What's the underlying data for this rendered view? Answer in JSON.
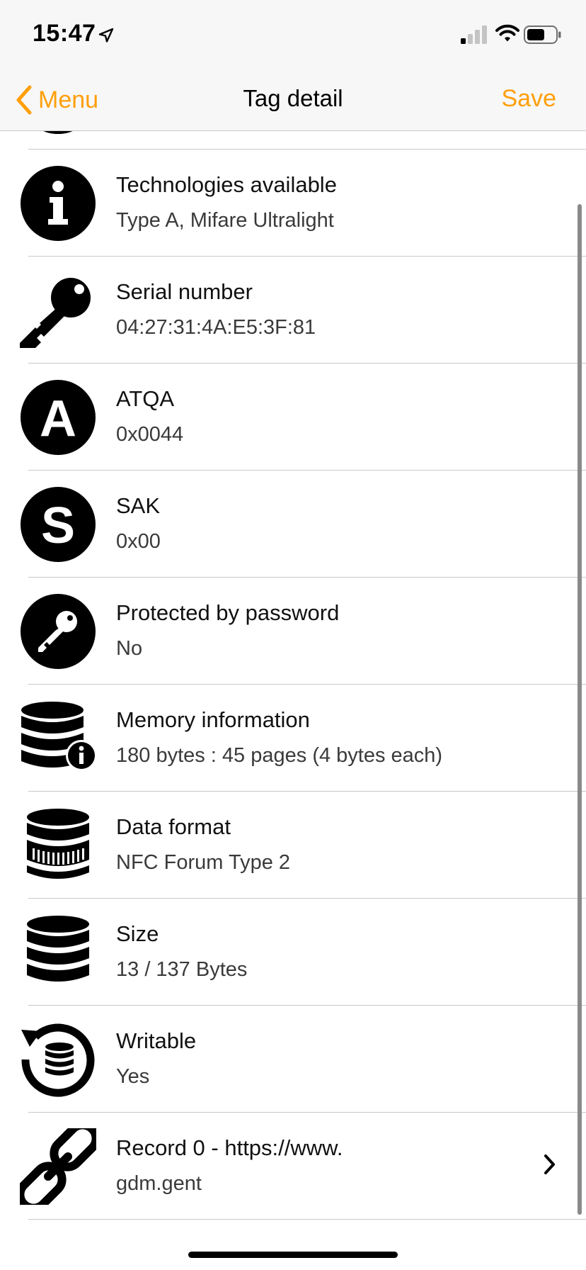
{
  "status_bar": {
    "time": "15:47"
  },
  "nav": {
    "back_label": "Menu",
    "title": "Tag detail",
    "save_label": "Save"
  },
  "rows": [
    {
      "icon": "info-icon",
      "title": "Technologies available",
      "value": "Type A, Mifare Ultralight"
    },
    {
      "icon": "key-icon",
      "title": "Serial number",
      "value": "04:27:31:4A:E5:3F:81"
    },
    {
      "icon": "letter-a-icon",
      "title": "ATQA",
      "value": "0x0044"
    },
    {
      "icon": "letter-s-icon",
      "title": "SAK",
      "value": "0x00"
    },
    {
      "icon": "password-key-icon",
      "title": "Protected by password",
      "value": "No"
    },
    {
      "icon": "database-info-icon",
      "title": "Memory information",
      "value": "180 bytes : 45 pages (4 bytes each)"
    },
    {
      "icon": "database-barcode-icon",
      "title": "Data format",
      "value": "NFC Forum Type 2"
    },
    {
      "icon": "database-icon",
      "title": "Size",
      "value": "13 / 137 Bytes"
    },
    {
      "icon": "database-refresh-icon",
      "title": "Writable",
      "value": "Yes"
    },
    {
      "icon": "link-icon",
      "title": "Record 0 - https://www.",
      "value": "gdm.gent"
    }
  ],
  "colors": {
    "accent": "#ff9f0a",
    "text": "#111111",
    "separator": "#c8c8c8",
    "bar_bg": "#f7f7f7"
  }
}
